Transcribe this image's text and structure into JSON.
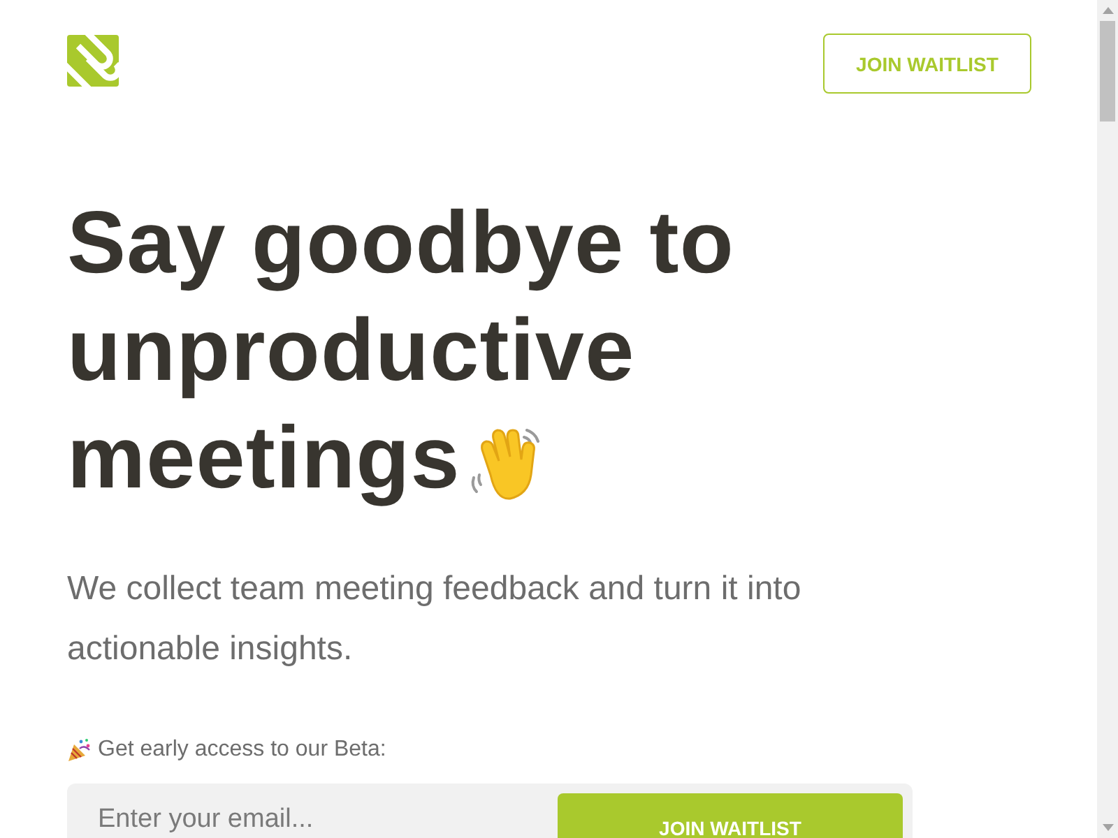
{
  "header": {
    "button": "JOIN WAITLIST"
  },
  "hero": {
    "heading_lines": [
      "Say goodbye to",
      "unproductive",
      "meetings"
    ],
    "subtitle": "We collect team meeting feedback and turn it into actionable insights.",
    "beta_note": "Get early access to our Beta:"
  },
  "waitlist_form": {
    "email_field": {
      "placeholder": "Enter your email..."
    },
    "button": "JOIN WAITLIST"
  }
}
